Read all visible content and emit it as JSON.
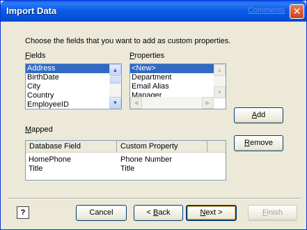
{
  "window": {
    "title": "Import Data",
    "comments_link": "Comments",
    "close_glyph": "✕"
  },
  "instruction": "Choose the fields that you want to add as custom properties.",
  "fields": {
    "label": "Fields",
    "label_access_key": "F",
    "label_rest": "ields",
    "items": [
      "Address",
      "BirthDate",
      "City",
      "Country",
      "EmployeeID"
    ],
    "selected_index": 0
  },
  "properties": {
    "label": "Properties",
    "label_access_key": "P",
    "label_rest": "roperties",
    "items": [
      "<New>",
      "Department",
      "Email Alias",
      "Manager"
    ],
    "selected_index": 0
  },
  "buttons": {
    "add_key": "A",
    "add_rest": "dd",
    "remove_key": "R",
    "remove_rest": "emove",
    "cancel": "Cancel",
    "back_arrow": "< ",
    "back_key": "B",
    "back_rest": "ack",
    "next_key": "N",
    "next_rest": "ext >",
    "finish_key": "F",
    "finish_rest": "inish"
  },
  "mapped": {
    "label": "Mapped",
    "label_access_key": "M",
    "label_rest": "apped",
    "columns": [
      "Database Field",
      "Custom Property"
    ],
    "rows": [
      {
        "field": "HomePhone",
        "property": "Phone Number"
      },
      {
        "field": "Title",
        "property": "Title"
      }
    ]
  },
  "help": {
    "glyph": "?"
  },
  "colors": {
    "titlebar": "#0453d9",
    "selection": "#316ac5",
    "dialog_bg": "#ece9d8"
  }
}
